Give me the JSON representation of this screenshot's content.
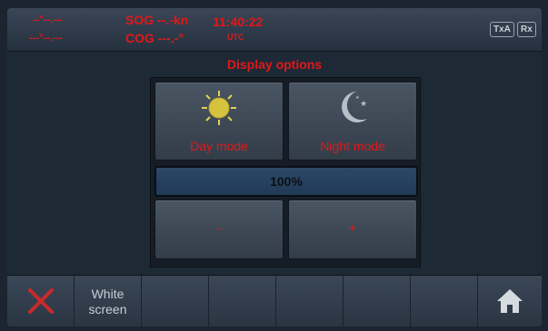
{
  "header": {
    "position": {
      "lat": "--°--.---",
      "lon": "---°--.---"
    },
    "sog": "SOG --.-kn",
    "cog": "COG ---.-°",
    "time": "11:40:22",
    "tz": "UTC",
    "txa": "TxA",
    "rx": "Rx"
  },
  "main": {
    "title": "Display options",
    "day_mode": "Day mode",
    "night_mode": "Night mode",
    "brightness": "100%",
    "brightness_fraction": 1.0,
    "decrease": "-",
    "increase": "+"
  },
  "bottom": {
    "white_line1": "White",
    "white_line2": "screen",
    "cancel_icon": "close-icon",
    "home_icon": "home-icon"
  },
  "colors": {
    "accent": "#e01818",
    "bar": "#2d4866"
  }
}
